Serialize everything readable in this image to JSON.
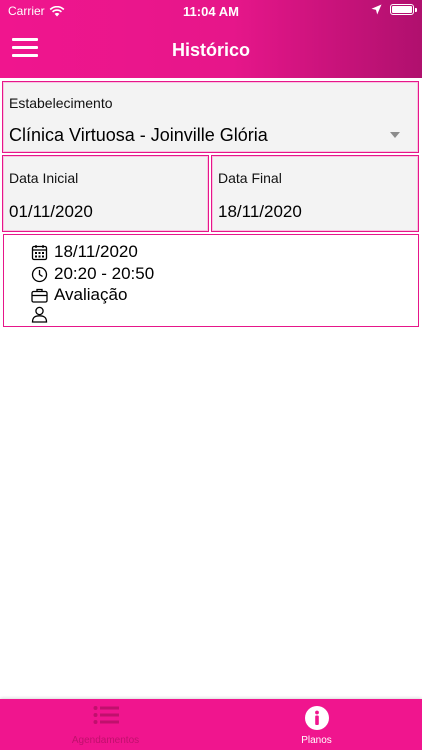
{
  "status_bar": {
    "carrier": "Carrier",
    "time": "11:04 AM"
  },
  "header": {
    "title": "Histórico"
  },
  "filters": {
    "establishment": {
      "label": "Estabelecimento",
      "value": "Clínica Virtuosa - Joinville Glória"
    },
    "start_date": {
      "label": "Data Inicial",
      "value": "01/11/2020"
    },
    "end_date": {
      "label": "Data Final",
      "value": "18/11/2020"
    }
  },
  "appointments": [
    {
      "date": "18/11/2020",
      "time": "20:20 - 20:50",
      "service": "Avaliação",
      "professional": ""
    }
  ],
  "tab_bar": {
    "tabs": [
      {
        "label": "Agendamentos",
        "icon": "list-icon",
        "active": false
      },
      {
        "label": "Planos",
        "icon": "info-icon",
        "active": true
      }
    ]
  },
  "colors": {
    "brand": "#e6168a",
    "brand_dark": "#b0106e",
    "field_bg": "#f3f3f3"
  }
}
